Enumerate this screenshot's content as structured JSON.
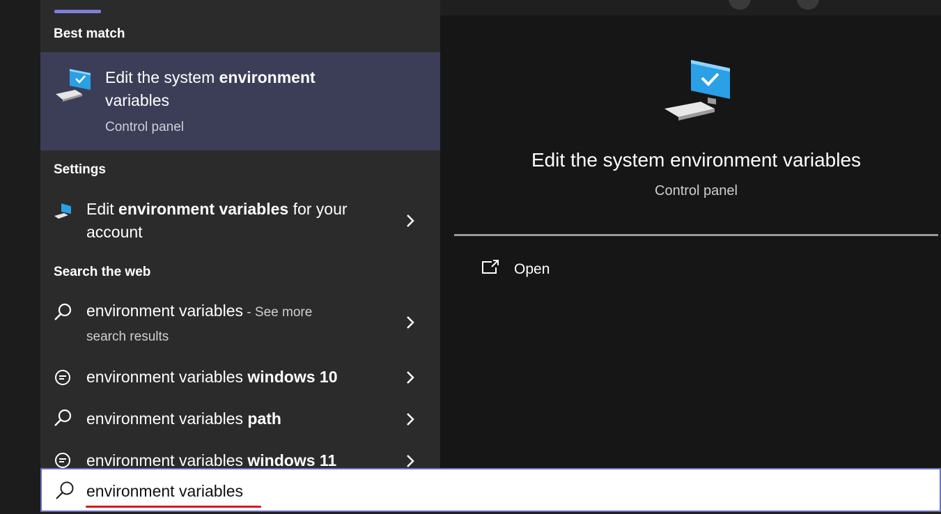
{
  "results": {
    "best_match_header": "Best match",
    "best_match": {
      "title_prefix": "Edit the system ",
      "title_bold": "environment",
      "title_line2": "variables",
      "subtitle": "Control panel"
    },
    "settings_header": "Settings",
    "settings_item": {
      "prefix": "Edit ",
      "bold": "environment variables",
      "suffix": " for your",
      "line2": "account"
    },
    "web_header": "Search the web",
    "web_items": [
      {
        "text": "environment variables",
        "bold": "",
        "extra": " - See more",
        "line2": "search results",
        "icon": "search-icon"
      },
      {
        "text": "environment variables ",
        "bold": "windows 10",
        "icon": "chat-bubble-icon"
      },
      {
        "text": "environment variables ",
        "bold": "path",
        "icon": "search-icon"
      },
      {
        "text": "environment variables ",
        "bold": "windows 11",
        "icon": "chat-bubble-icon"
      }
    ]
  },
  "preview": {
    "title": "Edit the system environment variables",
    "subtitle": "Control panel",
    "open_label": "Open"
  },
  "search": {
    "value": "environment variables"
  },
  "colors": {
    "selected_bg": "#3c3e58",
    "accent": "#7d7fd8",
    "underline": "#e0141e"
  }
}
